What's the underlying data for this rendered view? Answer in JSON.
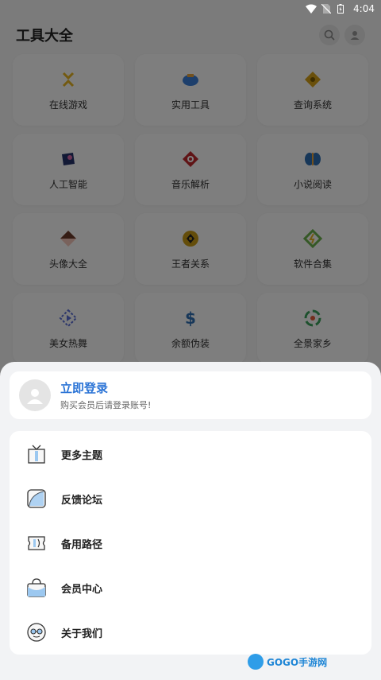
{
  "status_bar": {
    "time": "4:04"
  },
  "app_bar": {
    "title": "工具大全"
  },
  "tiles": [
    {
      "label": "在线游戏",
      "icon": "game-icon",
      "color": "#e6b422"
    },
    {
      "label": "实用工具",
      "icon": "tools-icon",
      "color": "#3b7fd9"
    },
    {
      "label": "查询系统",
      "icon": "query-icon",
      "color": "#d4a017"
    },
    {
      "label": "人工智能",
      "icon": "ai-icon",
      "color": "#3a5aa8"
    },
    {
      "label": "音乐解析",
      "icon": "music-icon",
      "color": "#c0282d"
    },
    {
      "label": "小说阅读",
      "icon": "book-icon",
      "color": "#2f6fb3"
    },
    {
      "label": "头像大全",
      "icon": "avatar-icon",
      "color": "#d9634a"
    },
    {
      "label": "王者关系",
      "icon": "king-icon",
      "color": "#c99a14"
    },
    {
      "label": "软件合集",
      "icon": "software-icon",
      "color": "#6ab04c"
    },
    {
      "label": "美女热舞",
      "icon": "video-icon",
      "color": "#5b6fd6"
    },
    {
      "label": "余额伪装",
      "icon": "dollar-icon",
      "color": "#2f6fb3"
    },
    {
      "label": "全景家乡",
      "icon": "panorama-icon",
      "color": "#3aa05a"
    }
  ],
  "sheet": {
    "login_title": "立即登录",
    "login_subtitle": "购买会员后请登录账号!",
    "menu": [
      {
        "label": "更多主题",
        "icon": "theme-icon"
      },
      {
        "label": "反馈论坛",
        "icon": "feedback-icon"
      },
      {
        "label": "备用路径",
        "icon": "route-icon"
      },
      {
        "label": "会员中心",
        "icon": "vip-bag-icon"
      },
      {
        "label": "关于我们",
        "icon": "about-icon"
      }
    ]
  },
  "watermark": {
    "text": "GOGO手游网"
  }
}
